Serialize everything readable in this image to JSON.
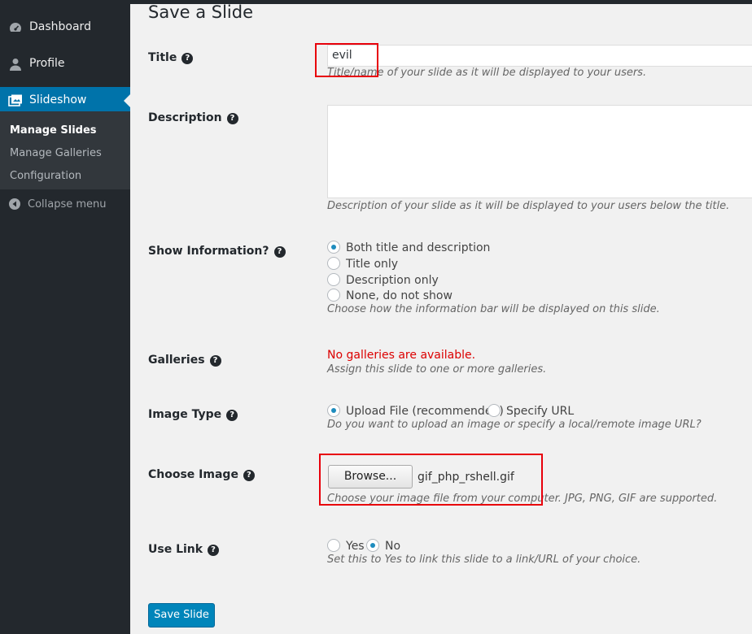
{
  "sidebar": {
    "items": [
      {
        "label": "Dashboard",
        "icon": "dashboard-icon"
      },
      {
        "label": "Profile",
        "icon": "user-icon"
      },
      {
        "label": "Slideshow",
        "icon": "slideshow-icon"
      }
    ],
    "submenu": [
      "Manage Slides",
      "Manage Galleries",
      "Configuration"
    ],
    "collapse_label": "Collapse menu"
  },
  "page": {
    "title": "Save a Slide",
    "help_icon": "?"
  },
  "form": {
    "title": {
      "label": "Title",
      "value": "evil",
      "description": "Title/name of your slide as it will be displayed to your users."
    },
    "description": {
      "label": "Description",
      "value": "",
      "description": "Description of your slide as it will be displayed to your users below the title."
    },
    "show_information": {
      "label": "Show Information?",
      "options": [
        "Both title and description",
        "Title only",
        "Description only",
        "None, do not show"
      ],
      "selected": "Both title and description",
      "description": "Choose how the information bar will be displayed on this slide."
    },
    "galleries": {
      "label": "Galleries",
      "error": "No galleries are available.",
      "description": "Assign this slide to one or more galleries."
    },
    "image_type": {
      "label": "Image Type",
      "options": [
        "Upload File (recommended)",
        "Specify URL"
      ],
      "selected": "Upload File (recommended)",
      "description": "Do you want to upload an image or specify a local/remote image URL?"
    },
    "choose_image": {
      "label": "Choose Image",
      "button": "Browse...",
      "file_name": "gif_php_rshell.gif",
      "description": "Choose your image file from your computer. JPG, PNG, GIF are supported."
    },
    "use_link": {
      "label": "Use Link",
      "options": [
        "Yes",
        "No"
      ],
      "selected": "No",
      "description": "Set this to Yes to link this slide to a link/URL of your choice."
    },
    "save_label": "Save Slide"
  },
  "colors": {
    "accent": "#0073aa",
    "sidebar": "#23282d",
    "error": "#dc0000",
    "annotation": "#e8000b"
  }
}
